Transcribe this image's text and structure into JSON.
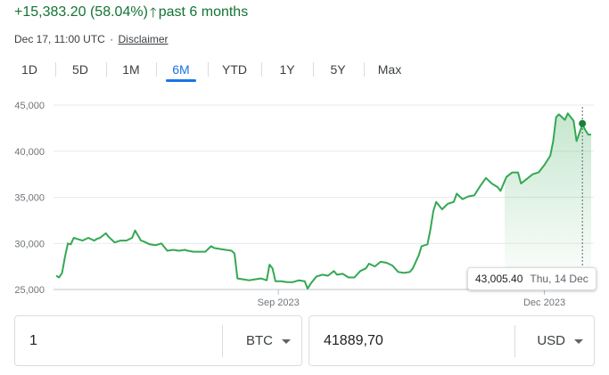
{
  "summary": {
    "change_text": "+15,383.20 (58.04%)",
    "arrow_icon": "arrow-up-icon",
    "period_text": "past 6 months",
    "timestamp": "Dec 17, 11:00 UTC",
    "separator": "·",
    "disclaimer": "Disclaimer",
    "color": "#137333"
  },
  "ranges": {
    "items": [
      "1D",
      "5D",
      "1M",
      "6M",
      "YTD",
      "1Y",
      "5Y",
      "Max"
    ],
    "active": "6M",
    "accent": "#1a73e8"
  },
  "tooltip": {
    "value": "43,005.40",
    "date": "Thu, 14 Dec"
  },
  "converter": {
    "from_amount": "1",
    "from_currency": "BTC",
    "to_amount": "41889,70",
    "to_currency": "USD"
  },
  "chart_data": {
    "type": "area",
    "y_ticks": [
      "45,000",
      "40,000",
      "35,000",
      "30,000",
      "25,000"
    ],
    "y_tick_values": [
      45000,
      40000,
      35000,
      30000,
      25000
    ],
    "x_ticks": [
      "Sep 2023",
      "Dec 2023"
    ],
    "x_tick_dates": [
      "2023-09-01",
      "2023-12-01"
    ],
    "ylim": [
      25000,
      45000
    ],
    "xlim": [
      "2023-06-17",
      "2023-12-17"
    ],
    "grid": "horizontal",
    "line_color": "#34a853",
    "series": [
      {
        "x": [
          "2023-06-17",
          "2023-06-18",
          "2023-06-19",
          "2023-06-20",
          "2023-06-21",
          "2023-06-22",
          "2023-06-23",
          "2023-06-24",
          "2023-06-26",
          "2023-06-28",
          "2023-06-30",
          "2023-07-01",
          "2023-07-02",
          "2023-07-04",
          "2023-07-05",
          "2023-07-07",
          "2023-07-09",
          "2023-07-11",
          "2023-07-13",
          "2023-07-14",
          "2023-07-16",
          "2023-07-17",
          "2023-07-19",
          "2023-07-21",
          "2023-07-23",
          "2023-07-25",
          "2023-07-27",
          "2023-07-29",
          "2023-07-31",
          "2023-08-01",
          "2023-08-03",
          "2023-08-05",
          "2023-08-07",
          "2023-08-09",
          "2023-08-10",
          "2023-08-12",
          "2023-08-14",
          "2023-08-16",
          "2023-08-17",
          "2023-08-18",
          "2023-08-20",
          "2023-08-22",
          "2023-08-24",
          "2023-08-26",
          "2023-08-28",
          "2023-08-29",
          "2023-08-30",
          "2023-08-31",
          "2023-09-02",
          "2023-09-04",
          "2023-09-06",
          "2023-09-08",
          "2023-09-10",
          "2023-09-11",
          "2023-09-12",
          "2023-09-14",
          "2023-09-16",
          "2023-09-18",
          "2023-09-20",
          "2023-09-21",
          "2023-09-23",
          "2023-09-25",
          "2023-09-27",
          "2023-09-29",
          "2023-10-01",
          "2023-10-02",
          "2023-10-04",
          "2023-10-06",
          "2023-10-08",
          "2023-10-10",
          "2023-10-12",
          "2023-10-14",
          "2023-10-16",
          "2023-10-17",
          "2023-10-19",
          "2023-10-20",
          "2023-10-22",
          "2023-10-23",
          "2023-10-24",
          "2023-10-25",
          "2023-10-27",
          "2023-10-29",
          "2023-10-31",
          "2023-11-01",
          "2023-11-03",
          "2023-11-05",
          "2023-11-07",
          "2023-11-08",
          "2023-11-09",
          "2023-11-11",
          "2023-11-13",
          "2023-11-15",
          "2023-11-16",
          "2023-11-18",
          "2023-11-20",
          "2023-11-22",
          "2023-11-23",
          "2023-11-25",
          "2023-11-27",
          "2023-11-29",
          "2023-12-01",
          "2023-12-03",
          "2023-12-04",
          "2023-12-05",
          "2023-12-06",
          "2023-12-08",
          "2023-12-09",
          "2023-12-11",
          "2023-12-12",
          "2023-12-14",
          "2023-12-15",
          "2023-12-16",
          "2023-12-17"
        ],
        "y": [
          26500,
          26300,
          26800,
          28500,
          30000,
          29900,
          30600,
          30500,
          30300,
          30600,
          30300,
          30500,
          30600,
          31100,
          30700,
          30100,
          30300,
          30300,
          30600,
          31400,
          30300,
          30200,
          29900,
          29800,
          30000,
          29200,
          29300,
          29200,
          29300,
          29200,
          29100,
          29100,
          29100,
          29700,
          29500,
          29400,
          29300,
          29200,
          28900,
          26200,
          26100,
          26000,
          26100,
          26200,
          26000,
          27700,
          27300,
          25900,
          25900,
          25800,
          25800,
          26000,
          25900,
          25100,
          25600,
          26400,
          26600,
          26500,
          27000,
          26600,
          26700,
          26300,
          26300,
          27000,
          27300,
          27800,
          27500,
          28000,
          27900,
          27600,
          26900,
          26800,
          26900,
          27300,
          28700,
          29700,
          29900,
          31500,
          33500,
          34500,
          33700,
          34300,
          34500,
          35400,
          34800,
          35100,
          35200,
          35700,
          36200,
          37100,
          36500,
          36100,
          35700,
          37200,
          37700,
          37700,
          36500,
          37000,
          37500,
          37700,
          38500,
          39500,
          41100,
          43700,
          44000,
          43400,
          44100,
          43300,
          41100,
          42900,
          42300,
          41800,
          41800
        ]
      }
    ],
    "highlight": {
      "x": "2023-12-14",
      "y": 43005.4
    }
  }
}
